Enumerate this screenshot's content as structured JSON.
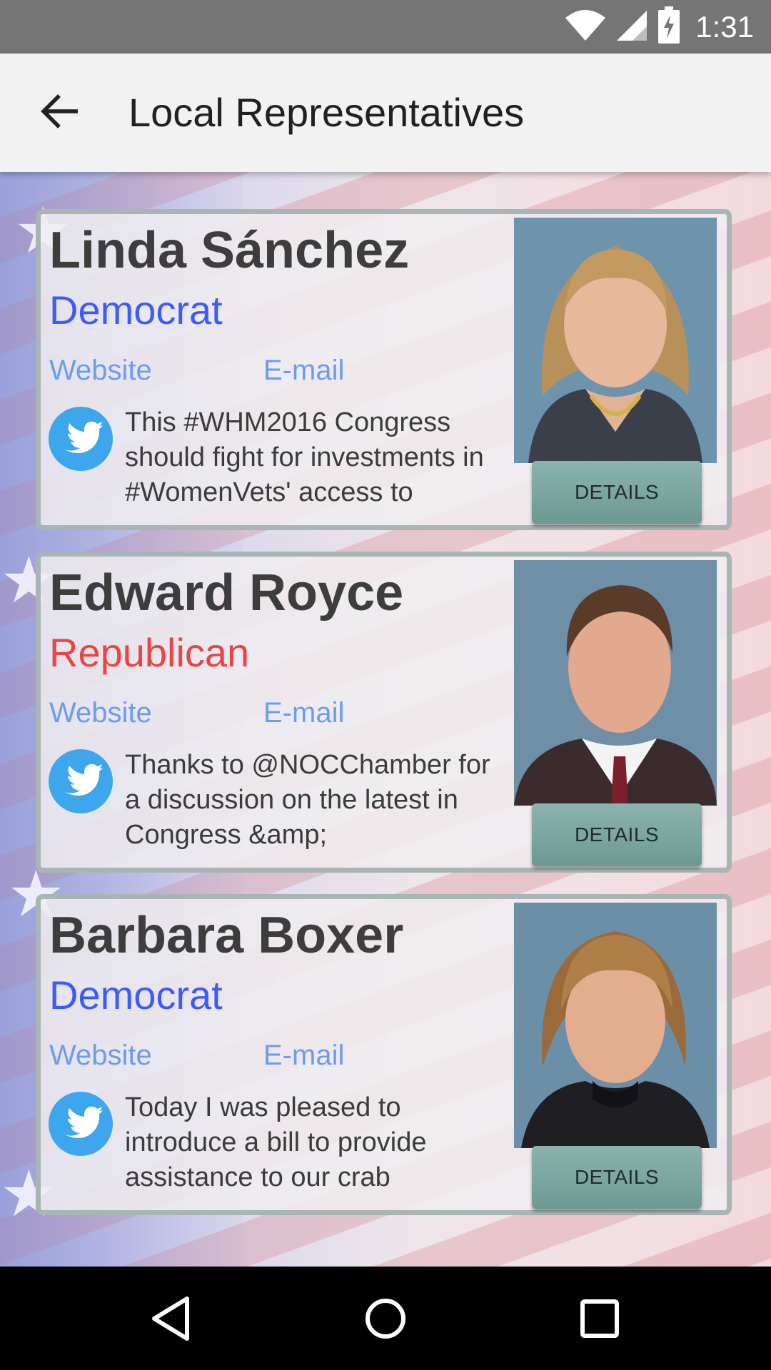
{
  "status_bar": {
    "time": "1:31",
    "icons": [
      "wifi-icon",
      "signal-icon",
      "battery-charging-icon"
    ]
  },
  "app_bar": {
    "title": "Local Representatives",
    "back_icon": "arrow-back-icon"
  },
  "representatives": [
    {
      "name": "Linda Sánchez",
      "party": "Democrat",
      "website_label": "Website",
      "email_label": "E-mail",
      "tweet": "This #WHM2016 Congress should fight for investments in #WomenVets' access to",
      "details_label": "DETAILS"
    },
    {
      "name": "Edward Royce",
      "party": "Republican",
      "website_label": "Website",
      "email_label": "E-mail",
      "tweet": "Thanks to @NOCChamber for a discussion on the latest in Congress &amp;",
      "details_label": "DETAILS"
    },
    {
      "name": "Barbara Boxer",
      "party": "Democrat",
      "website_label": "Website",
      "email_label": "E-mail",
      "tweet": "Today I was pleased to introduce a bill to provide assistance to our crab",
      "details_label": "DETAILS"
    }
  ],
  "colors": {
    "democrat": "#3d5afe",
    "republican": "#e84545",
    "link": "#6b9cf0",
    "twitter": "#42a5f5",
    "details_button": "#7aa6a0"
  },
  "nav_bar": {
    "icons": [
      "back-triangle-icon",
      "home-circle-icon",
      "recents-square-icon"
    ]
  }
}
